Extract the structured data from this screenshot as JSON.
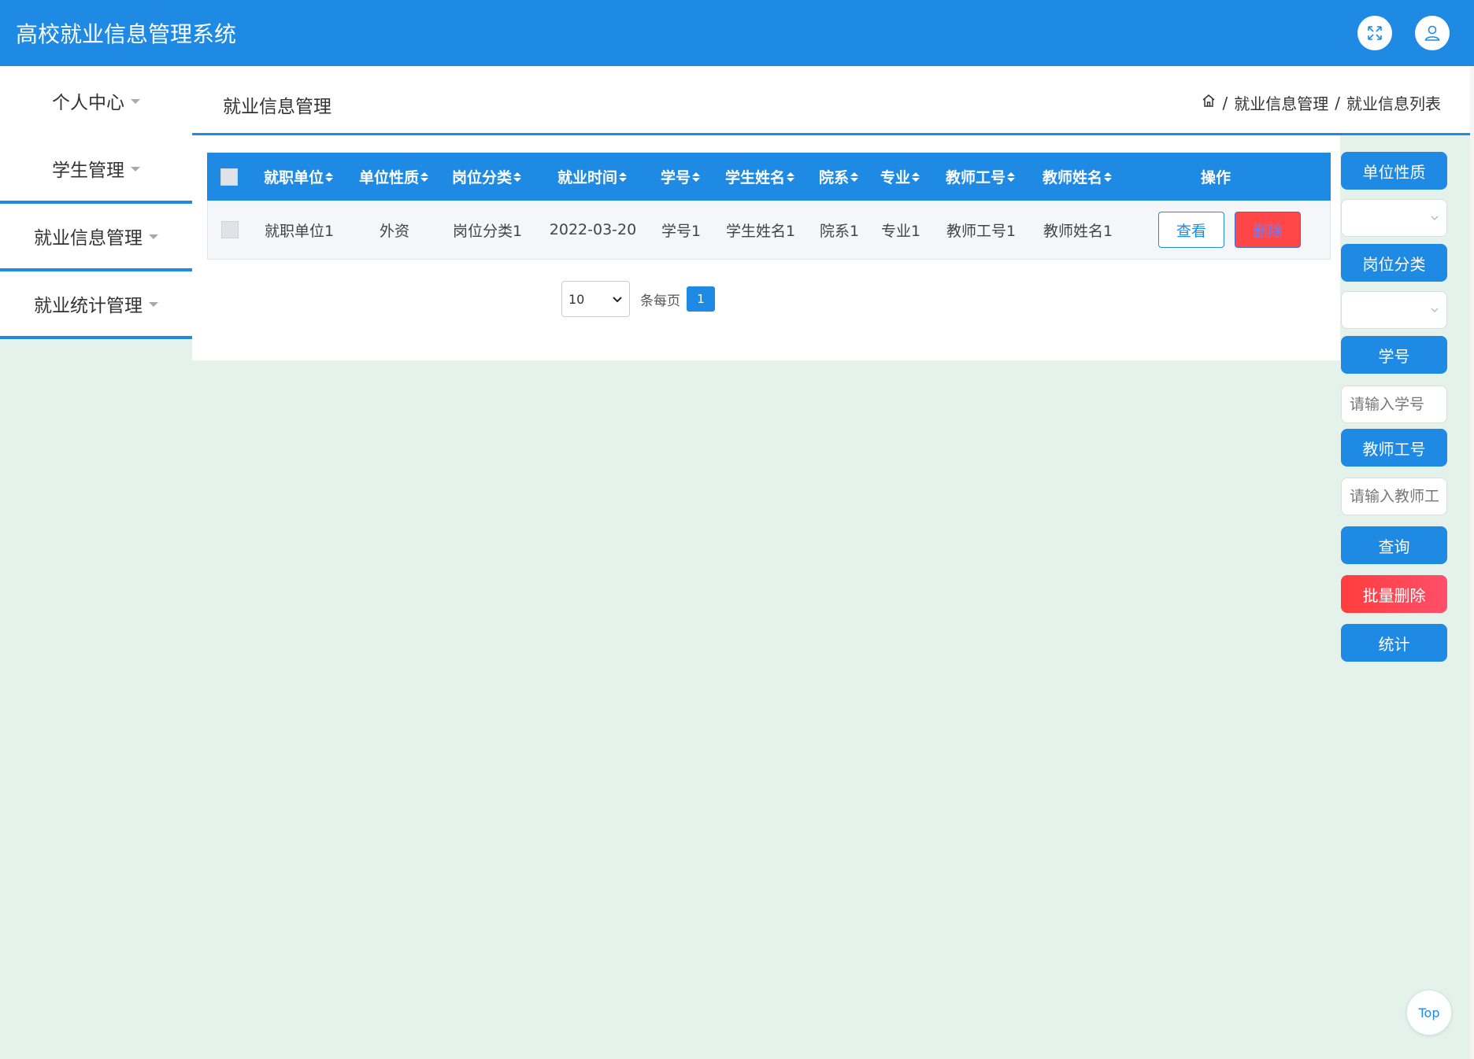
{
  "header": {
    "app_title": "高校就业信息管理系统",
    "fullscreen_icon": "expand-icon",
    "user_icon": "user-icon",
    "accent_color": "#1f8ae4"
  },
  "sidebar": {
    "items": [
      {
        "label": "个人中心"
      },
      {
        "label": "学生管理"
      },
      {
        "label": "就业信息管理"
      },
      {
        "label": "就业统计管理"
      }
    ]
  },
  "page": {
    "title": "就业信息管理",
    "breadcrumb": {
      "home_icon": "home-icon",
      "level1": "就业信息管理",
      "level2": "就业信息列表",
      "separator": "/"
    }
  },
  "table": {
    "columns": [
      "就职单位",
      "单位性质",
      "岗位分类",
      "就业时间",
      "学号",
      "学生姓名",
      "院系",
      "专业",
      "教师工号",
      "教师姓名",
      "操作"
    ],
    "rows": [
      {
        "cells": [
          "就职单位1",
          "外资",
          "岗位分类1",
          "2022-03-20",
          "学号1",
          "学生姓名1",
          "院系1",
          "专业1",
          "教师工号1",
          "教师姓名1"
        ],
        "view_label": "查看",
        "delete_label": "删除"
      }
    ]
  },
  "pagination": {
    "page_size": "10",
    "per_page_label": "条每页",
    "current_page": "1"
  },
  "filters": {
    "unit_nature_label": "单位性质",
    "job_category_label": "岗位分类",
    "student_id_label": "学号",
    "student_id_placeholder": "请输入学号",
    "teacher_id_label": "教师工号",
    "teacher_id_placeholder": "请输入教师工号",
    "search_label": "查询",
    "batch_delete_label": "批量删除",
    "stats_label": "统计"
  },
  "back_to_top": "Top"
}
